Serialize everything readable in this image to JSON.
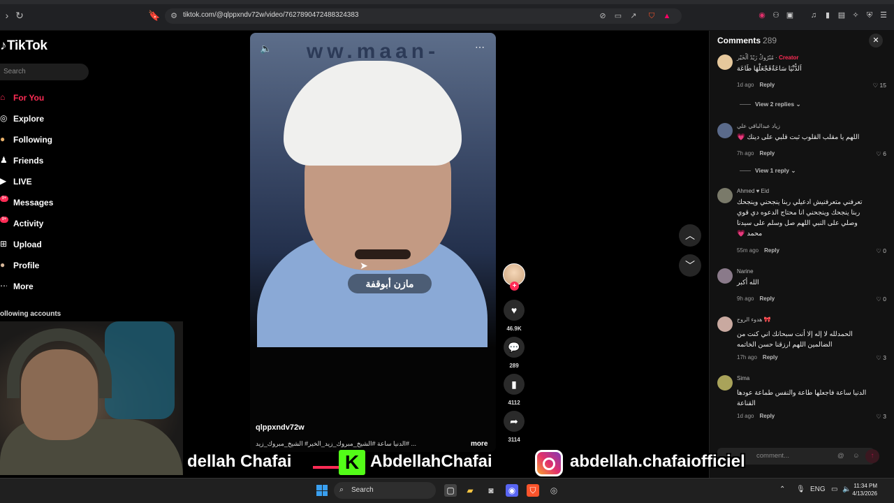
{
  "browser": {
    "url": "tiktok.com/@qlppxndv72w/video/7627890472488324383"
  },
  "sidebar": {
    "logo": "TikTok",
    "search_placeholder": "Search",
    "items": [
      {
        "label": "For You",
        "icon": "home-icon",
        "active": true
      },
      {
        "label": "Explore",
        "icon": "compass-icon"
      },
      {
        "label": "Following",
        "icon": "following-icon"
      },
      {
        "label": "Friends",
        "icon": "friends-icon"
      },
      {
        "label": "LIVE",
        "icon": "live-icon"
      },
      {
        "label": "Messages",
        "icon": "messages-icon",
        "badge": "9+"
      },
      {
        "label": "Activity",
        "icon": "activity-icon",
        "badge": "9+"
      },
      {
        "label": "Upload",
        "icon": "upload-icon"
      },
      {
        "label": "Profile",
        "icon": "profile-icon"
      },
      {
        "label": "More",
        "icon": "more-icon"
      }
    ],
    "following_header": "ollowing accounts"
  },
  "video": {
    "watermark": "ww.maan-",
    "subtitle": "مازن أبوقفة",
    "author": "qlppxndv72w",
    "description": "الدنيا ساعة #الشيخ_مبروك_زيد_الخير# الشيخ_مبروك_زيد# ...",
    "more": "more"
  },
  "actions": {
    "likes": "46.9K",
    "comments": "289",
    "saves": "4112",
    "shares": "3114"
  },
  "comments": {
    "title": "Comments",
    "count": "289",
    "add_placeholder": "comment...",
    "reply_label": "Reply",
    "items": [
      {
        "name": "مُبْرُوكْ زَيْدْ ألْخَيْر",
        "creator": "Creator",
        "text": "اَلدُّنْيَا سَاعَةٌفَجْعَلْهَا طَاعَة",
        "time": "1d ago",
        "likes": "15",
        "replies": "View 2 replies"
      },
      {
        "name": "زياد عبدالباقي علي",
        "text": "اللهم يا مقلب القلوب ثبت قلبي على دينك 💗",
        "time": "7h ago",
        "likes": "6",
        "replies": "View 1 reply"
      },
      {
        "name": "Ahmed ♥ Eid",
        "text": "تعرفني متعرفنيش ادعيلي ربنا ينجحني وينجحك ربنا ينجحك وينجحني انا محتاج الدعوه دي قوي وصلي على النبي اللهم صل وسلم على سيدنا محمد 💗",
        "time": "55m ago",
        "likes": "0"
      },
      {
        "name": "Narine",
        "text": "الله أكبر",
        "time": "9h ago",
        "likes": "0"
      },
      {
        "name": "هدوء الروح 🎀",
        "text": "الحمدلله لا إله إلا أنت سبحانك اني كنت من الضالمين اللهم ارزقنا حسن الخاتمه",
        "time": "17h ago",
        "likes": "3"
      },
      {
        "name": "Sima",
        "text": "الدنيا ساعة فاجعلها طاعة والنفس طماعة عودها القناعة",
        "time": "1d ago",
        "likes": "3"
      }
    ]
  },
  "banner": {
    "left_text": "dellah Chafai",
    "kick_text": "AbdellahChafai",
    "ig_text": "abdellah.chafaiofficiel"
  },
  "taskbar": {
    "search": "Search",
    "lang": "ENG",
    "time": "11:34 PM",
    "date": "4/13/2026"
  }
}
